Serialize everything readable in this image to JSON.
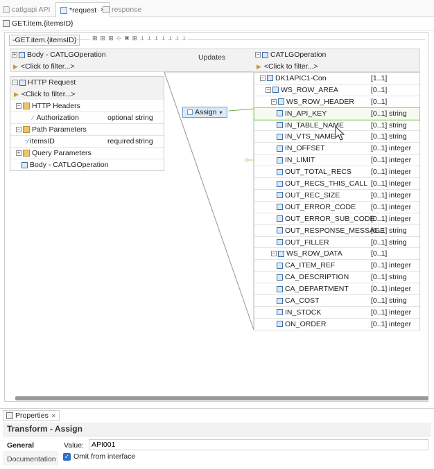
{
  "tabs": [
    {
      "label": "catlgapi API"
    },
    {
      "label": "*request"
    },
    {
      "label": "response"
    }
  ],
  "breadcrumb": "GET.item.{itemsID}",
  "operation_title": "-GET.item.{itemsID}",
  "updates_label": "Updates",
  "assign_label": "Assign",
  "left": {
    "body_title": "Body - CATLGOperation",
    "body_filter": "<Click to filter...>",
    "http_title": "HTTP Request",
    "http_filter": "<Click to filter...>",
    "headers_label": "HTTP Headers",
    "auth_label": "Authorization",
    "auth_req": "optional",
    "auth_type": "string",
    "path_label": "Path Parameters",
    "items_label": "itemsID",
    "items_req": "required",
    "items_type": "string",
    "query_label": "Query Parameters",
    "body2_label": "Body - CATLGOperation"
  },
  "right": {
    "title": "CATLGOperation",
    "filter": "<Click to filter...>",
    "rows": [
      {
        "name": "DK1APIC1-Con",
        "card": "[1..1]",
        "type": ""
      },
      {
        "name": "WS_ROW_AREA",
        "card": "[0..1]",
        "type": ""
      },
      {
        "name": "WS_ROW_HEADER",
        "card": "[0..1]",
        "type": ""
      },
      {
        "name": "IN_API_KEY",
        "card": "[0..1]",
        "type": "string"
      },
      {
        "name": "IN_TABLE_NAME",
        "card": "[0..1]",
        "type": "string"
      },
      {
        "name": "IN_VTS_NAME",
        "card": "[0..1]",
        "type": "string"
      },
      {
        "name": "IN_OFFSET",
        "card": "[0..1]",
        "type": "integer"
      },
      {
        "name": "IN_LIMIT",
        "card": "[0..1]",
        "type": "integer"
      },
      {
        "name": "OUT_TOTAL_RECS",
        "card": "[0..1]",
        "type": "integer"
      },
      {
        "name": "OUT_RECS_THIS_CALL",
        "card": "[0..1]",
        "type": "integer"
      },
      {
        "name": "OUT_REC_SIZE",
        "card": "[0..1]",
        "type": "integer"
      },
      {
        "name": "OUT_ERROR_CODE",
        "card": "[0..1]",
        "type": "integer"
      },
      {
        "name": "OUT_ERROR_SUB_CODE",
        "card": "[0..1]",
        "type": "integer"
      },
      {
        "name": "OUT_RESPONSE_MESSAGE",
        "card": "[0..1]",
        "type": "string"
      },
      {
        "name": "OUT_FILLER",
        "card": "[0..1]",
        "type": "string"
      },
      {
        "name": "WS_ROW_DATA",
        "card": "[0..1]",
        "type": ""
      },
      {
        "name": "CA_ITEM_REF",
        "card": "[0..1]",
        "type": "integer"
      },
      {
        "name": "CA_DESCRIPTION",
        "card": "[0..1]",
        "type": "string"
      },
      {
        "name": "CA_DEPARTMENT",
        "card": "[0..1]",
        "type": "integer"
      },
      {
        "name": "CA_COST",
        "card": "[0..1]",
        "type": "string"
      },
      {
        "name": "IN_STOCK",
        "card": "[0..1]",
        "type": "integer"
      },
      {
        "name": "ON_ORDER",
        "card": "[0..1]",
        "type": "integer"
      }
    ]
  },
  "properties": {
    "tab_label": "Properties",
    "title": "Transform - Assign",
    "general_label": "General",
    "documentation_label": "Documentation",
    "value_label": "Value:",
    "value": "API001",
    "omit_label": "Omit from interface"
  },
  "colors": {
    "accent": "#3a6ea5",
    "mapping_line": "#6ab04c",
    "highlight_border": "#9bcf7a"
  }
}
